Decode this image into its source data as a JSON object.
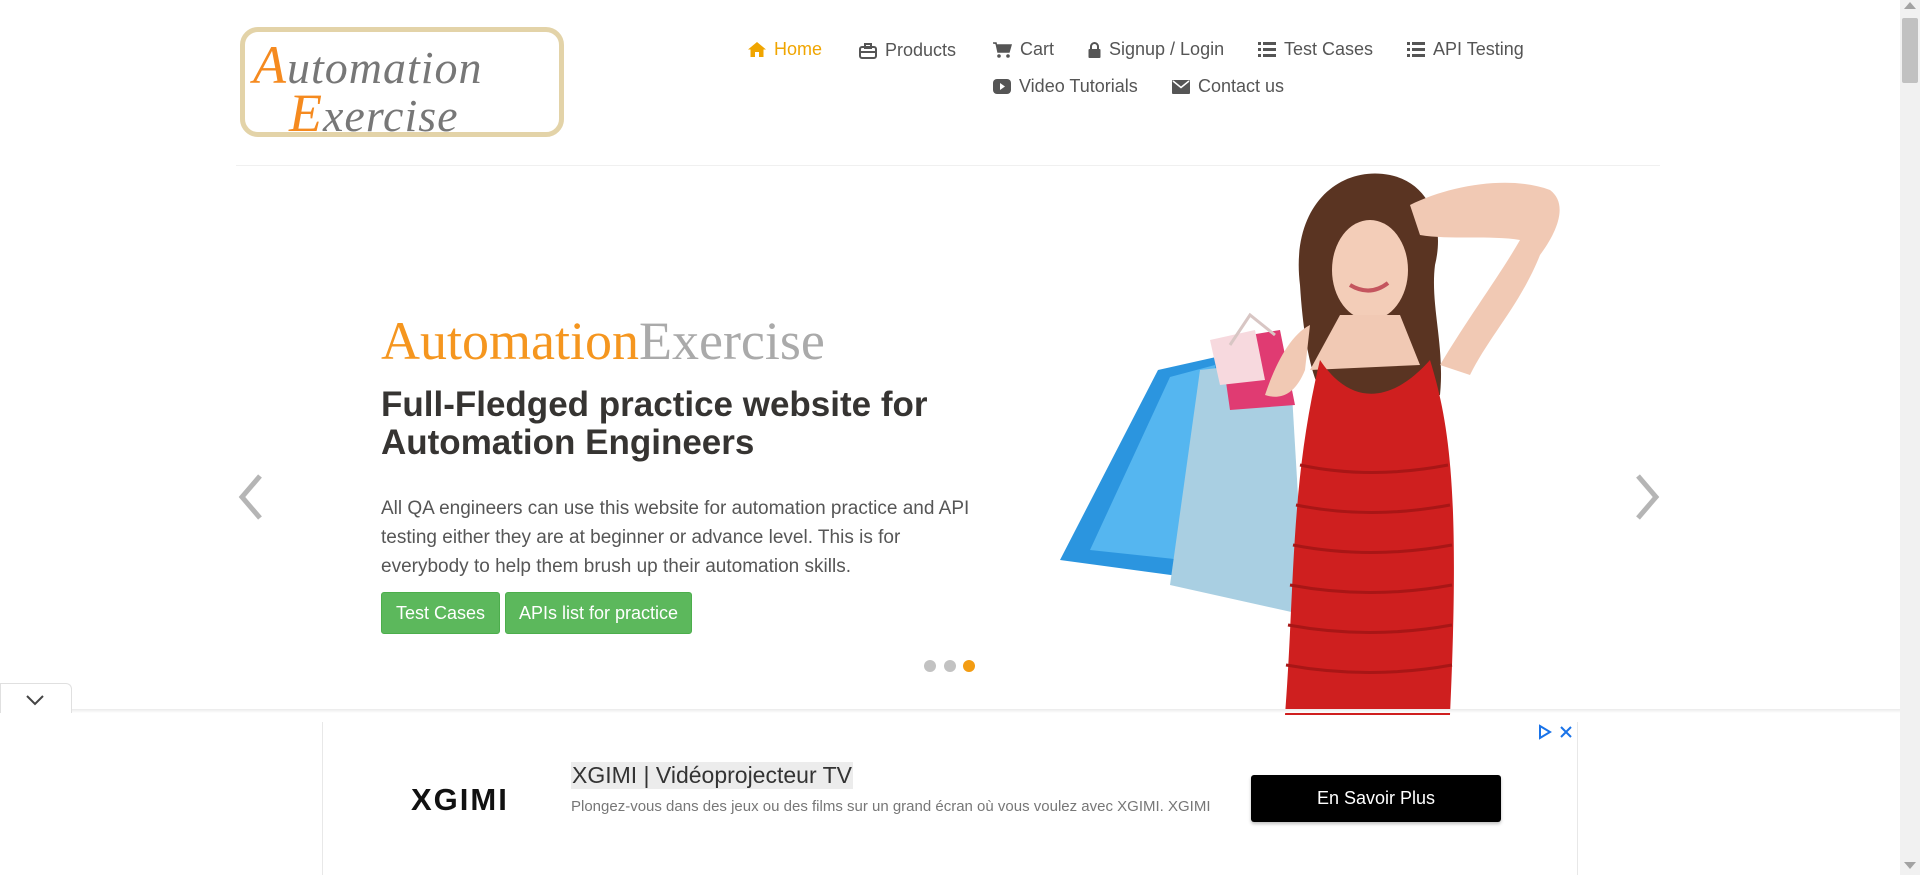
{
  "logo": {
    "line1_cap": "A",
    "line1_rest": "utomation",
    "line2_cap": "E",
    "line2_rest": "xercise"
  },
  "nav": {
    "home": "Home",
    "products": "Products",
    "cart": "Cart",
    "signup_login": "Signup / Login",
    "test_cases": "Test Cases",
    "api_testing": "API Testing",
    "video_tutorials": "Video Tutorials",
    "contact_us": "Contact us"
  },
  "hero": {
    "title_part1": "Automation",
    "title_part2": "Exercise",
    "subtitle": "Full-Fledged practice website for Automation Engineers",
    "description": "All QA engineers can use this website for automation practice and API testing either they are at beginner or advance level. This is for everybody to help them brush up their automation skills.",
    "btn_test_cases": "Test Cases",
    "btn_apis": "APIs list for practice",
    "active_slide": 3,
    "slide_count": 3
  },
  "ad": {
    "brand": "XGIMI",
    "title": "XGIMI | Vidéoprojecteur TV",
    "description": "Plongez-vous dans des jeux ou des films sur un grand écran où vous voulez avec XGIMI. XGIMI",
    "cta": "En Savoir Plus"
  },
  "colors": {
    "accent_orange": "#f0a500",
    "title_orange": "#f5961f",
    "button_green": "#5cb85c",
    "nav_text": "#555555",
    "ad_cta_bg": "#000000",
    "ad_icon_blue": "#1a73e8"
  },
  "icons": [
    "home-icon",
    "briefcase-icon",
    "cart-icon",
    "lock-icon",
    "list-icon",
    "youtube-play-icon",
    "envelope-icon",
    "chevron-left-icon",
    "chevron-right-icon",
    "chevron-down-icon",
    "adchoices-icon",
    "close-icon"
  ]
}
